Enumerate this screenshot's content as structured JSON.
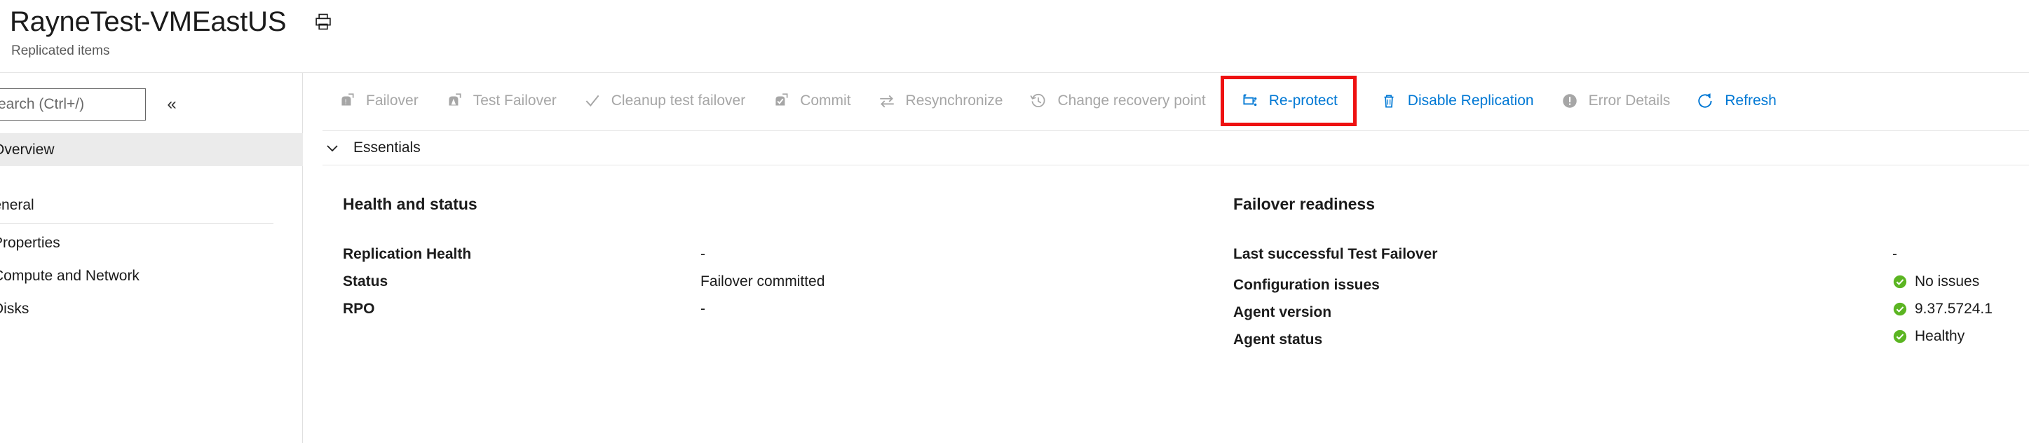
{
  "header": {
    "title": "RayneTest-VMEastUS",
    "subtitle": "Replicated items",
    "print_icon": "print-icon"
  },
  "sidebar": {
    "search": {
      "placeholder": "Search (Ctrl+/)",
      "value": ""
    },
    "collapse_glyph": "«",
    "items": [
      {
        "label": "Overview",
        "selected": true,
        "type": "item"
      },
      {
        "label": "General",
        "selected": false,
        "type": "section"
      },
      {
        "label": "Properties",
        "selected": false,
        "type": "item"
      },
      {
        "label": "Compute and Network",
        "selected": false,
        "type": "item"
      },
      {
        "label": "Disks",
        "selected": false,
        "type": "item"
      }
    ]
  },
  "commandbar": {
    "items": [
      {
        "label": "Failover",
        "icon": "failover-icon",
        "enabled": false,
        "highlighted": false
      },
      {
        "label": "Test Failover",
        "icon": "test-failover-icon",
        "enabled": false,
        "highlighted": false
      },
      {
        "label": "Cleanup test failover",
        "icon": "checkmark-icon",
        "enabled": false,
        "highlighted": false
      },
      {
        "label": "Commit",
        "icon": "commit-icon",
        "enabled": false,
        "highlighted": false
      },
      {
        "label": "Resynchronize",
        "icon": "resynchronize-icon",
        "enabled": false,
        "highlighted": false
      },
      {
        "label": "Change recovery point",
        "icon": "clock-history-icon",
        "enabled": false,
        "highlighted": false
      },
      {
        "label": "Re-protect",
        "icon": "re-protect-icon",
        "enabled": true,
        "highlighted": true
      },
      {
        "label": "Disable Replication",
        "icon": "trash-icon",
        "enabled": true,
        "highlighted": false
      },
      {
        "label": "Error Details",
        "icon": "error-icon",
        "enabled": false,
        "highlighted": false
      },
      {
        "label": "Refresh",
        "icon": "refresh-icon",
        "enabled": true,
        "highlighted": false
      }
    ]
  },
  "essentials": {
    "label": "Essentials",
    "chevron": "chevron-down-icon"
  },
  "main": {
    "left_column": {
      "heading": "Health and status",
      "rows": [
        {
          "key": "Replication Health",
          "value": "-",
          "status": false
        },
        {
          "key": "Status",
          "value": "Failover committed",
          "status": false
        },
        {
          "key": "RPO",
          "value": "-",
          "status": false
        }
      ]
    },
    "right_column": {
      "heading": "Failover readiness",
      "rows": [
        {
          "key": "Last successful Test Failover",
          "value": "-",
          "status": false
        },
        {
          "key": "Configuration issues",
          "value": "No issues",
          "status": true
        },
        {
          "key": "Agent version",
          "value": "9.37.5724.1",
          "status": true
        },
        {
          "key": "Agent status",
          "value": "Healthy",
          "status": true
        }
      ]
    }
  },
  "colors": {
    "accent": "#0078d4",
    "disabled": "#a6a6a6",
    "highlight_box": "#ee1111",
    "status_ok": "#5bb522",
    "selected_row": "#ebebeb"
  }
}
